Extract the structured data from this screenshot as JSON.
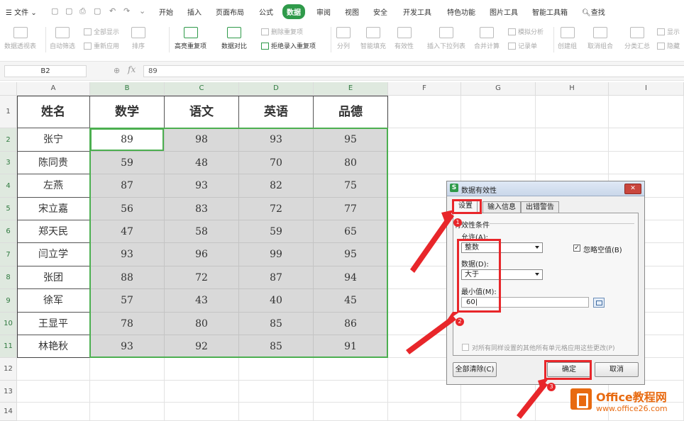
{
  "menubar": {
    "file": "文件",
    "tabs": [
      "开始",
      "插入",
      "页面布局",
      "公式",
      "数据",
      "审阅",
      "视图",
      "安全",
      "开发工具",
      "特色功能",
      "图片工具",
      "智能工具箱"
    ],
    "active_tab": "数据",
    "search": "查找"
  },
  "ribbon": {
    "pivot": "数据透视表",
    "autofilter": "自动筛选",
    "show_all": "全部显示",
    "reapply": "重新应用",
    "sort": "排序",
    "highlight_dup": "高亮重复项",
    "compare": "数据对比",
    "delete_dup": "删除重复项",
    "reject_dup": "拒绝录入重复项",
    "split": "分列",
    "smart_fill": "智能填充",
    "validity": "有效性",
    "dropdown": "插入下拉列表",
    "merge_calc": "合并计算",
    "simulate": "模拟分析",
    "record": "记录单",
    "create_group": "创建组",
    "ungroup": "取消组合",
    "subtotal": "分类汇总",
    "show_detail": "显示",
    "hide_detail": "隐藏"
  },
  "formula_bar": {
    "cell_ref": "B2",
    "fx": "fx",
    "value": "89"
  },
  "columns": [
    "A",
    "B",
    "C",
    "D",
    "E",
    "F",
    "G",
    "H",
    "I"
  ],
  "rows": [
    "1",
    "2",
    "3",
    "4",
    "5",
    "6",
    "7",
    "8",
    "9",
    "10",
    "11",
    "12",
    "13",
    "14"
  ],
  "table": {
    "headers": [
      "姓名",
      "数学",
      "语文",
      "英语",
      "品德"
    ],
    "rows": [
      [
        "张宁",
        "89",
        "98",
        "93",
        "95"
      ],
      [
        "陈同贵",
        "59",
        "48",
        "70",
        "80"
      ],
      [
        "左燕",
        "87",
        "93",
        "82",
        "75"
      ],
      [
        "宋立嘉",
        "56",
        "83",
        "72",
        "77"
      ],
      [
        "郑天民",
        "47",
        "58",
        "59",
        "65"
      ],
      [
        "闫立学",
        "93",
        "96",
        "99",
        "95"
      ],
      [
        "张团",
        "88",
        "72",
        "87",
        "94"
      ],
      [
        "徐军",
        "57",
        "43",
        "40",
        "45"
      ],
      [
        "王显平",
        "78",
        "80",
        "85",
        "86"
      ],
      [
        "林艳秋",
        "93",
        "92",
        "85",
        "91"
      ]
    ]
  },
  "dialog": {
    "title": "数据有效性",
    "tabs": [
      "设置",
      "输入信息",
      "出错警告"
    ],
    "group_label": "有效性条件",
    "allow_label": "允许(A):",
    "allow_value": "整数",
    "ignore_blank": "忽略空值(B)",
    "data_label": "数据(D):",
    "data_value": "大于",
    "min_label": "最小值(M):",
    "min_value": "60",
    "apply_all": "对所有同样设置的其他所有单元格应用这些更改(P)",
    "clear_all": "全部清除(C)",
    "ok": "确定",
    "cancel": "取消"
  },
  "annotations": {
    "badge1": "1",
    "badge2": "2",
    "badge3": "3",
    "color": "#e8262a"
  },
  "watermark": {
    "brand": "Office教程网",
    "url": "www.office26.com"
  }
}
